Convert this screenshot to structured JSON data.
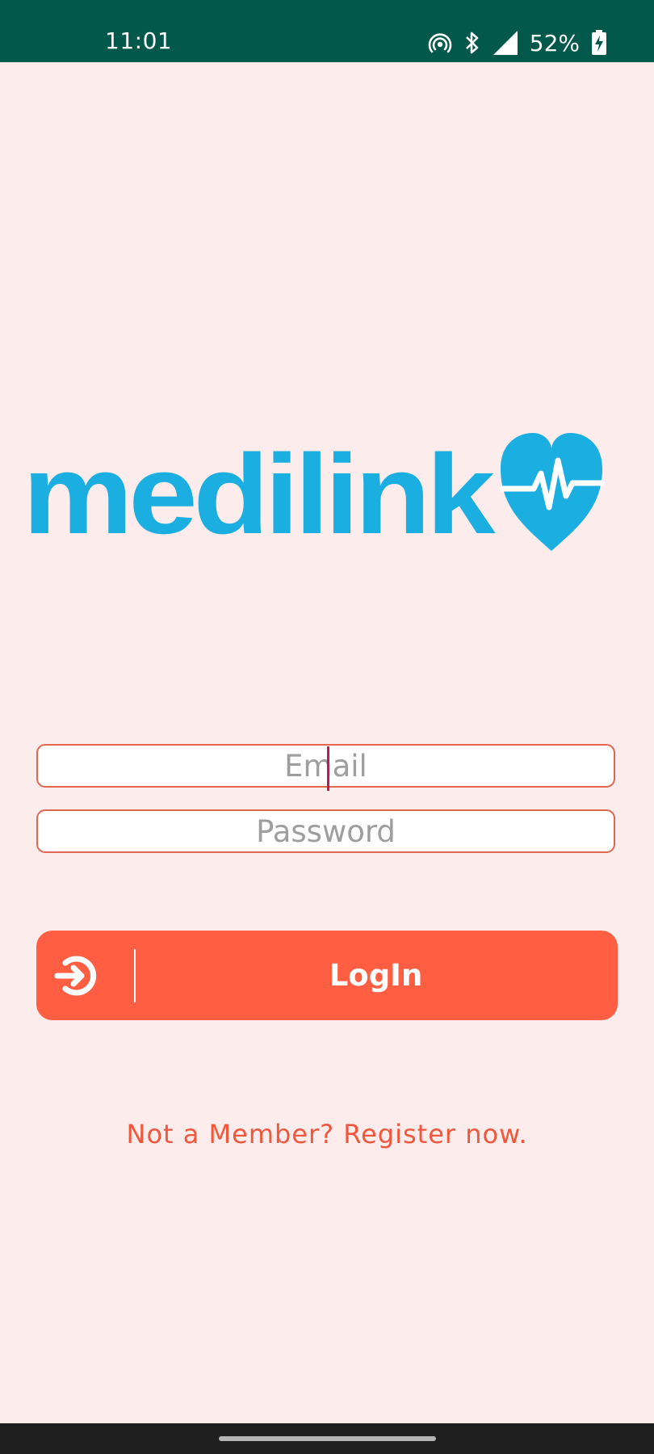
{
  "status_bar": {
    "time": "11:01",
    "battery_percent": "52%",
    "icons": [
      "hotspot-icon",
      "bluetooth-icon",
      "cell-signal-icon",
      "battery-charging-icon"
    ],
    "background": "#03584C"
  },
  "logo": {
    "text": "medilink",
    "color": "#1AAEE1"
  },
  "form": {
    "email_placeholder": "Email",
    "email_value": "",
    "password_placeholder": "Password",
    "password_value": "",
    "accent": "#E2674F"
  },
  "login": {
    "label": "LogIn",
    "icon": "login-icon",
    "color": "#FF5E43"
  },
  "register": {
    "text": "Not a Member? Register now.",
    "color": "#F0573D"
  },
  "theme": {
    "background": "#FDECEC"
  }
}
